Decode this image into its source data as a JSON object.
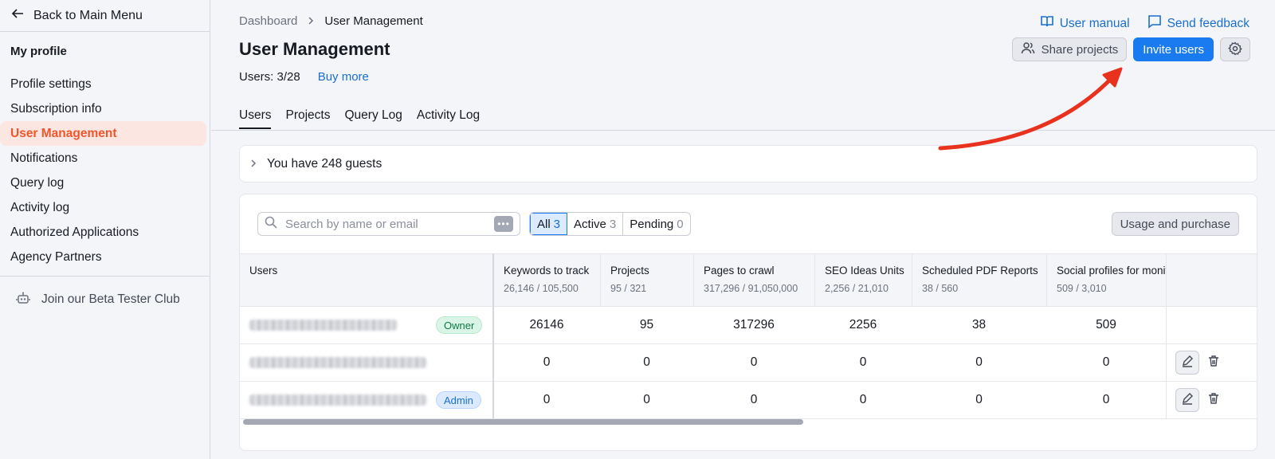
{
  "sidebar": {
    "back_label": "Back to Main Menu",
    "heading": "My profile",
    "items": [
      {
        "label": "Profile settings",
        "active": false
      },
      {
        "label": "Subscription info",
        "active": false
      },
      {
        "label": "User Management",
        "active": true
      },
      {
        "label": "Notifications",
        "active": false
      },
      {
        "label": "Query log",
        "active": false
      },
      {
        "label": "Activity log",
        "active": false
      },
      {
        "label": "Authorized Applications",
        "active": false
      },
      {
        "label": "Agency Partners",
        "active": false
      }
    ],
    "beta_label": "Join our Beta Tester Club"
  },
  "header": {
    "breadcrumb": [
      "Dashboard",
      "User Management"
    ],
    "title": "User Management",
    "users_count": "Users: 3/28",
    "buy_more": "Buy more",
    "user_manual": "User manual",
    "send_feedback": "Send feedback",
    "share_projects": "Share projects",
    "invite_users": "Invite users"
  },
  "tabs": [
    "Users",
    "Projects",
    "Query Log",
    "Activity Log"
  ],
  "guests": {
    "label": "You have 248 guests"
  },
  "toolbar": {
    "search_placeholder": "Search by name or email",
    "filters": [
      {
        "label": "All",
        "count": "3",
        "active": true
      },
      {
        "label": "Active",
        "count": "3",
        "active": false
      },
      {
        "label": "Pending",
        "count": "0",
        "active": false
      }
    ],
    "usage_label": "Usage and purchase"
  },
  "table": {
    "columns": [
      {
        "label": "Users",
        "sub": ""
      },
      {
        "label": "Keywords to track",
        "sub": "26,146 / 105,500"
      },
      {
        "label": "Projects",
        "sub": "95 / 321"
      },
      {
        "label": "Pages to crawl",
        "sub": "317,296 / 91,050,000"
      },
      {
        "label": "SEO Ideas Units",
        "sub": "2,256 / 21,010"
      },
      {
        "label": "Scheduled PDF Reports",
        "sub": "38 / 560"
      },
      {
        "label": "Social profiles for monit",
        "sub": "509 / 3,010"
      }
    ],
    "rows": [
      {
        "role": "Owner",
        "values": [
          "26146",
          "95",
          "317296",
          "2256",
          "38",
          "509"
        ],
        "editable": false
      },
      {
        "role": "",
        "values": [
          "0",
          "0",
          "0",
          "0",
          "0",
          "0"
        ],
        "editable": true
      },
      {
        "role": "Admin",
        "values": [
          "0",
          "0",
          "0",
          "0",
          "0",
          "0"
        ],
        "editable": true
      }
    ]
  },
  "colors": {
    "accent": "#1a7bf0",
    "active_nav": "#f0562b",
    "arrow": "#e8321e"
  }
}
